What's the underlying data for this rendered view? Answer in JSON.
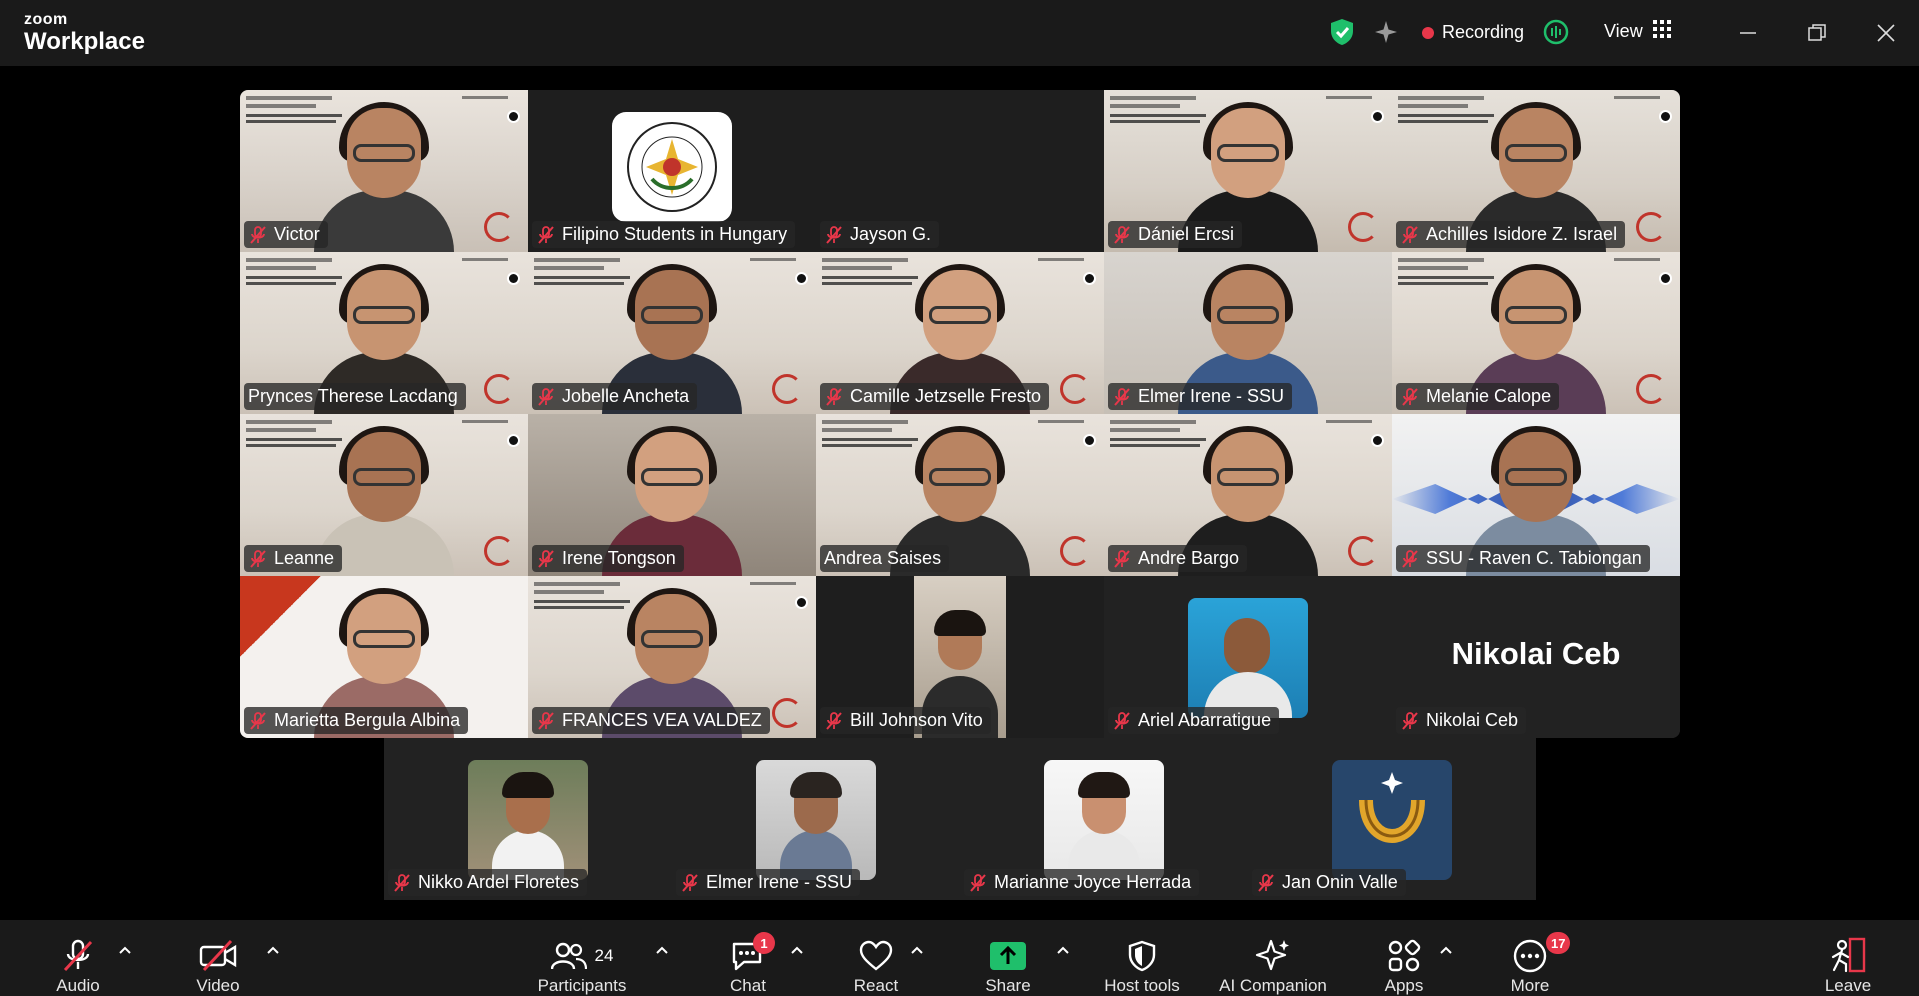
{
  "app": {
    "logo_top": "zoom",
    "logo_bottom": "Workplace"
  },
  "titlebar": {
    "recording_label": "Recording",
    "view_label": "View",
    "icons": [
      "shield-check-icon",
      "ai-sparkle-icon",
      "record-dot-icon",
      "ai-summary-icon",
      "grid-icon",
      "minimize-icon",
      "restore-icon",
      "close-icon"
    ],
    "colors": {
      "shield": "#1fbf6b",
      "record": "#e8374a",
      "ai_summary": "#1fbf6b"
    }
  },
  "participants_grid": [
    {
      "name": "Victor",
      "muted": true
    },
    {
      "name": "Filipino Students in Hungary",
      "muted": true
    },
    {
      "name": "Jayson G.",
      "muted": true
    },
    {
      "name": "Dániel Ercsi",
      "muted": true
    },
    {
      "name": "Achilles Isidore Z. Israel",
      "muted": true
    },
    {
      "name": "Prynces Therese Lacdang",
      "muted": false
    },
    {
      "name": "Jobelle Ancheta",
      "muted": true
    },
    {
      "name": "Camille Jetzselle Fresto",
      "muted": true
    },
    {
      "name": "Elmer Irene - SSU",
      "muted": true
    },
    {
      "name": "Melanie Calope",
      "muted": true
    },
    {
      "name": "Leanne",
      "muted": true
    },
    {
      "name": "Irene Tongson",
      "muted": true
    },
    {
      "name": "Andrea Saises",
      "muted": false,
      "active_speaker": true
    },
    {
      "name": "Andre Bargo",
      "muted": true
    },
    {
      "name": "SSU - Raven C. Tabiongan",
      "muted": true
    },
    {
      "name": "Marietta Bergula Albina",
      "muted": true
    },
    {
      "name": "FRANCES VEA VALDEZ",
      "muted": true
    },
    {
      "name": "Bill Johnson Vito",
      "muted": true
    },
    {
      "name": "Ariel Abarratigue",
      "muted": true
    },
    {
      "name": "Nikolai Ceb",
      "muted": true,
      "display_name_large": "Nikolai Ceb"
    }
  ],
  "participants_bottom": [
    {
      "name": "Nikko Ardel Floretes",
      "muted": true
    },
    {
      "name": "Elmer Irene - SSU",
      "muted": true
    },
    {
      "name": "Marianne Joyce Herrada",
      "muted": true
    },
    {
      "name": "Jan Onin Valle",
      "muted": true
    }
  ],
  "toolbar": {
    "audio": "Audio",
    "video": "Video",
    "participants": "Participants",
    "participants_count": "24",
    "chat": "Chat",
    "chat_badge": "1",
    "react": "React",
    "share": "Share",
    "host_tools": "Host tools",
    "ai_companion": "AI Companion",
    "apps": "Apps",
    "more": "More",
    "more_badge": "17",
    "leave": "Leave",
    "colors": {
      "share": "#1fbf6b",
      "leave": "#e8374a",
      "badge": "#e8374a"
    }
  }
}
